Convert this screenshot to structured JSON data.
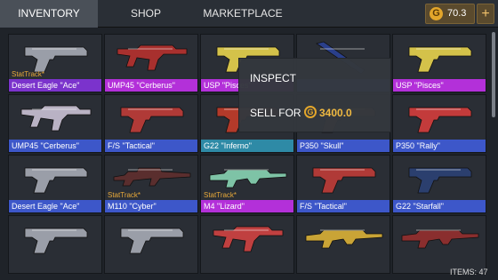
{
  "tabs": {
    "inventory": "INVENTORY",
    "shop": "SHOP",
    "marketplace": "MARKETPLACE"
  },
  "currency": {
    "icon": "coin-icon",
    "glyph": "G",
    "amount": "70.3",
    "add_label": "+"
  },
  "stattrak_label": "StatTrack*",
  "items": [
    {
      "name": "Desert Eagle \"Ace\"",
      "rarity": "purple",
      "stattrak": true,
      "kind": "pistol",
      "color": "#9a9ea8"
    },
    {
      "name": "UMP45 \"Cerberus\"",
      "rarity": "magenta",
      "stattrak": false,
      "kind": "smg",
      "color": "#a8302e"
    },
    {
      "name": "USP \"Pisces\"",
      "rarity": "magenta",
      "stattrak": false,
      "kind": "pistol",
      "color": "#d4c24a"
    },
    {
      "name": "",
      "rarity": "blue",
      "stattrak": false,
      "kind": "knife",
      "color": "#2a3f8a"
    },
    {
      "name": "USP \"Pisces\"",
      "rarity": "magenta",
      "stattrak": false,
      "kind": "pistol",
      "color": "#d4c24a"
    },
    {
      "name": "UMP45 \"Cerberus\"",
      "rarity": "blue",
      "stattrak": false,
      "kind": "smg",
      "color": "#b9b2c4"
    },
    {
      "name": "F/S \"Tactical\"",
      "rarity": "blue",
      "stattrak": false,
      "kind": "pistol",
      "color": "#b03a37"
    },
    {
      "name": "G22 \"Inferno\"",
      "rarity": "teal",
      "stattrak": false,
      "kind": "pistol",
      "color": "#b33a2a"
    },
    {
      "name": "P350 \"Skull\"",
      "rarity": "blue",
      "stattrak": false,
      "kind": "pistol",
      "color": "#7a4a22"
    },
    {
      "name": "P350 \"Rally\"",
      "rarity": "blue",
      "stattrak": false,
      "kind": "pistol",
      "color": "#c33b3b"
    },
    {
      "name": "Desert Eagle \"Ace\"",
      "rarity": "blue",
      "stattrak": false,
      "kind": "pistol",
      "color": "#9a9ea8"
    },
    {
      "name": "M110 \"Cyber\"",
      "rarity": "blue",
      "stattrak": true,
      "kind": "sniper",
      "color": "#5a2e2e"
    },
    {
      "name": "M4 \"Lizard\"",
      "rarity": "magenta",
      "stattrak": true,
      "kind": "rifle",
      "color": "#7ec3a6"
    },
    {
      "name": "F/S \"Tactical\"",
      "rarity": "blue",
      "stattrak": false,
      "kind": "pistol",
      "color": "#b03a37"
    },
    {
      "name": "G22 \"Starfall\"",
      "rarity": "blue",
      "stattrak": false,
      "kind": "pistol",
      "color": "#2b3f6e"
    },
    {
      "name": "",
      "rarity": "",
      "stattrak": false,
      "kind": "pistol",
      "color": "#9a9ea8"
    },
    {
      "name": "",
      "rarity": "",
      "stattrak": false,
      "kind": "pistol",
      "color": "#9a9ea8"
    },
    {
      "name": "",
      "rarity": "",
      "stattrak": false,
      "kind": "smg",
      "color": "#c04040"
    },
    {
      "name": "",
      "rarity": "",
      "stattrak": false,
      "kind": "rifle",
      "color": "#c9a436"
    },
    {
      "name": "",
      "rarity": "",
      "stattrak": false,
      "kind": "rifle",
      "color": "#8a2e2e"
    }
  ],
  "popup": {
    "inspect_label": "INSPECT",
    "sell_label": "SELL FOR",
    "sell_icon_glyph": "G",
    "sell_price": "3400.0"
  },
  "items_count": "ITEMS: 47"
}
